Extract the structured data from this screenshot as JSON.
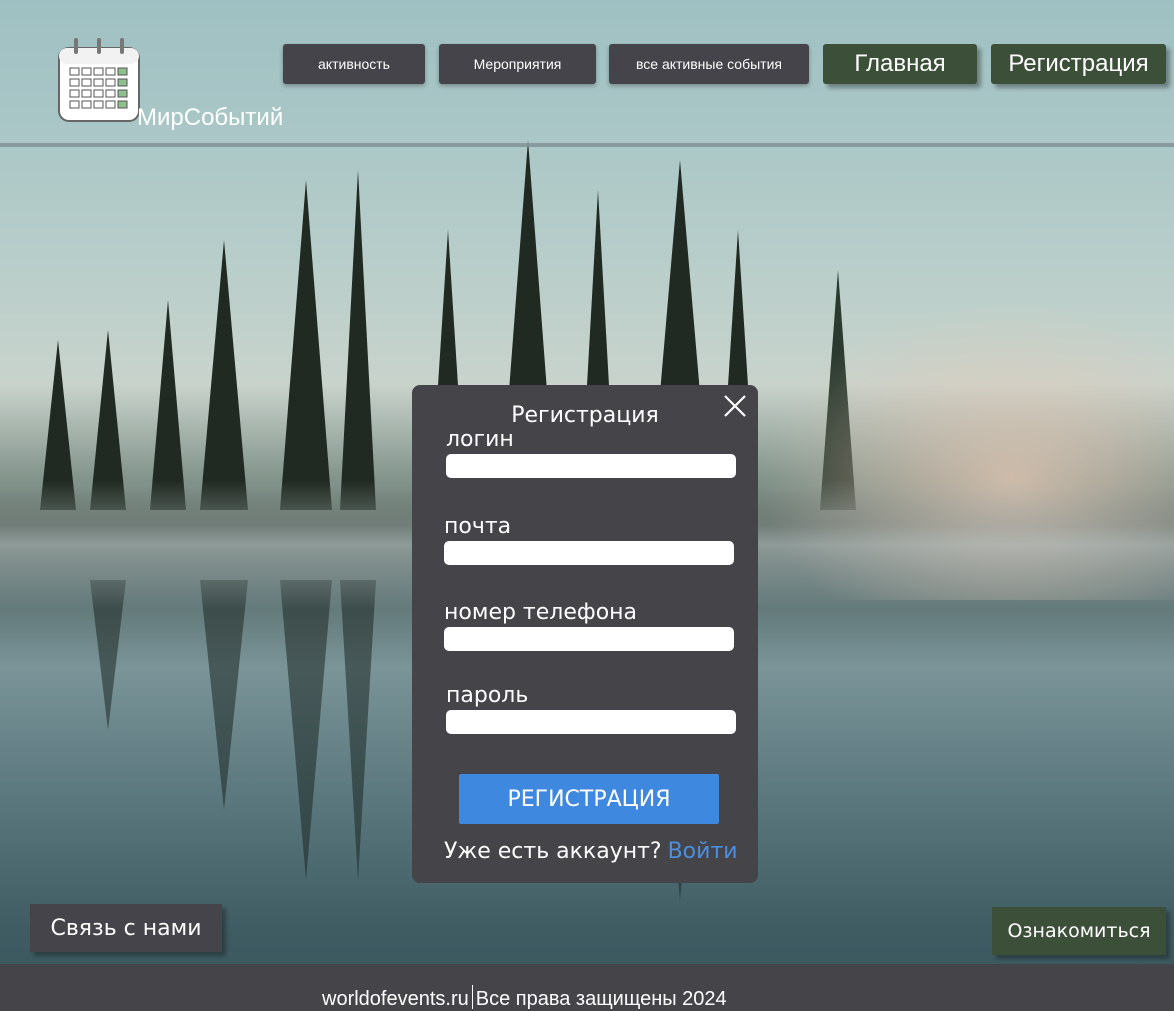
{
  "brand": {
    "name": "МирСобытий",
    "logo_icon": "calendar-icon"
  },
  "nav": {
    "activity": "активность",
    "events": "Мероприятия",
    "all_active": "все активные события",
    "home": "Главная",
    "register": "Регистрация"
  },
  "modal": {
    "title": "Регистрация",
    "close_icon": "close-icon",
    "fields": [
      {
        "label": "логин",
        "value": ""
      },
      {
        "label": "почта",
        "value": ""
      },
      {
        "label": "номер телефона",
        "value": ""
      },
      {
        "label": "пароль",
        "value": ""
      }
    ],
    "submit": "РЕГИСТРАЦИЯ",
    "has_account": "Уже есть аккаунт?",
    "login_link": "Войти"
  },
  "contact_button": "Связь с нами",
  "learn_button": "Ознакомиться",
  "footer": {
    "domain": "worldofevents.ru",
    "rights": "Все права защищены 2024"
  },
  "colors": {
    "panel": "#444449",
    "green_button": "#3c4f39",
    "primary_blue": "#3f88e0",
    "link_blue": "#4a8fe0"
  }
}
